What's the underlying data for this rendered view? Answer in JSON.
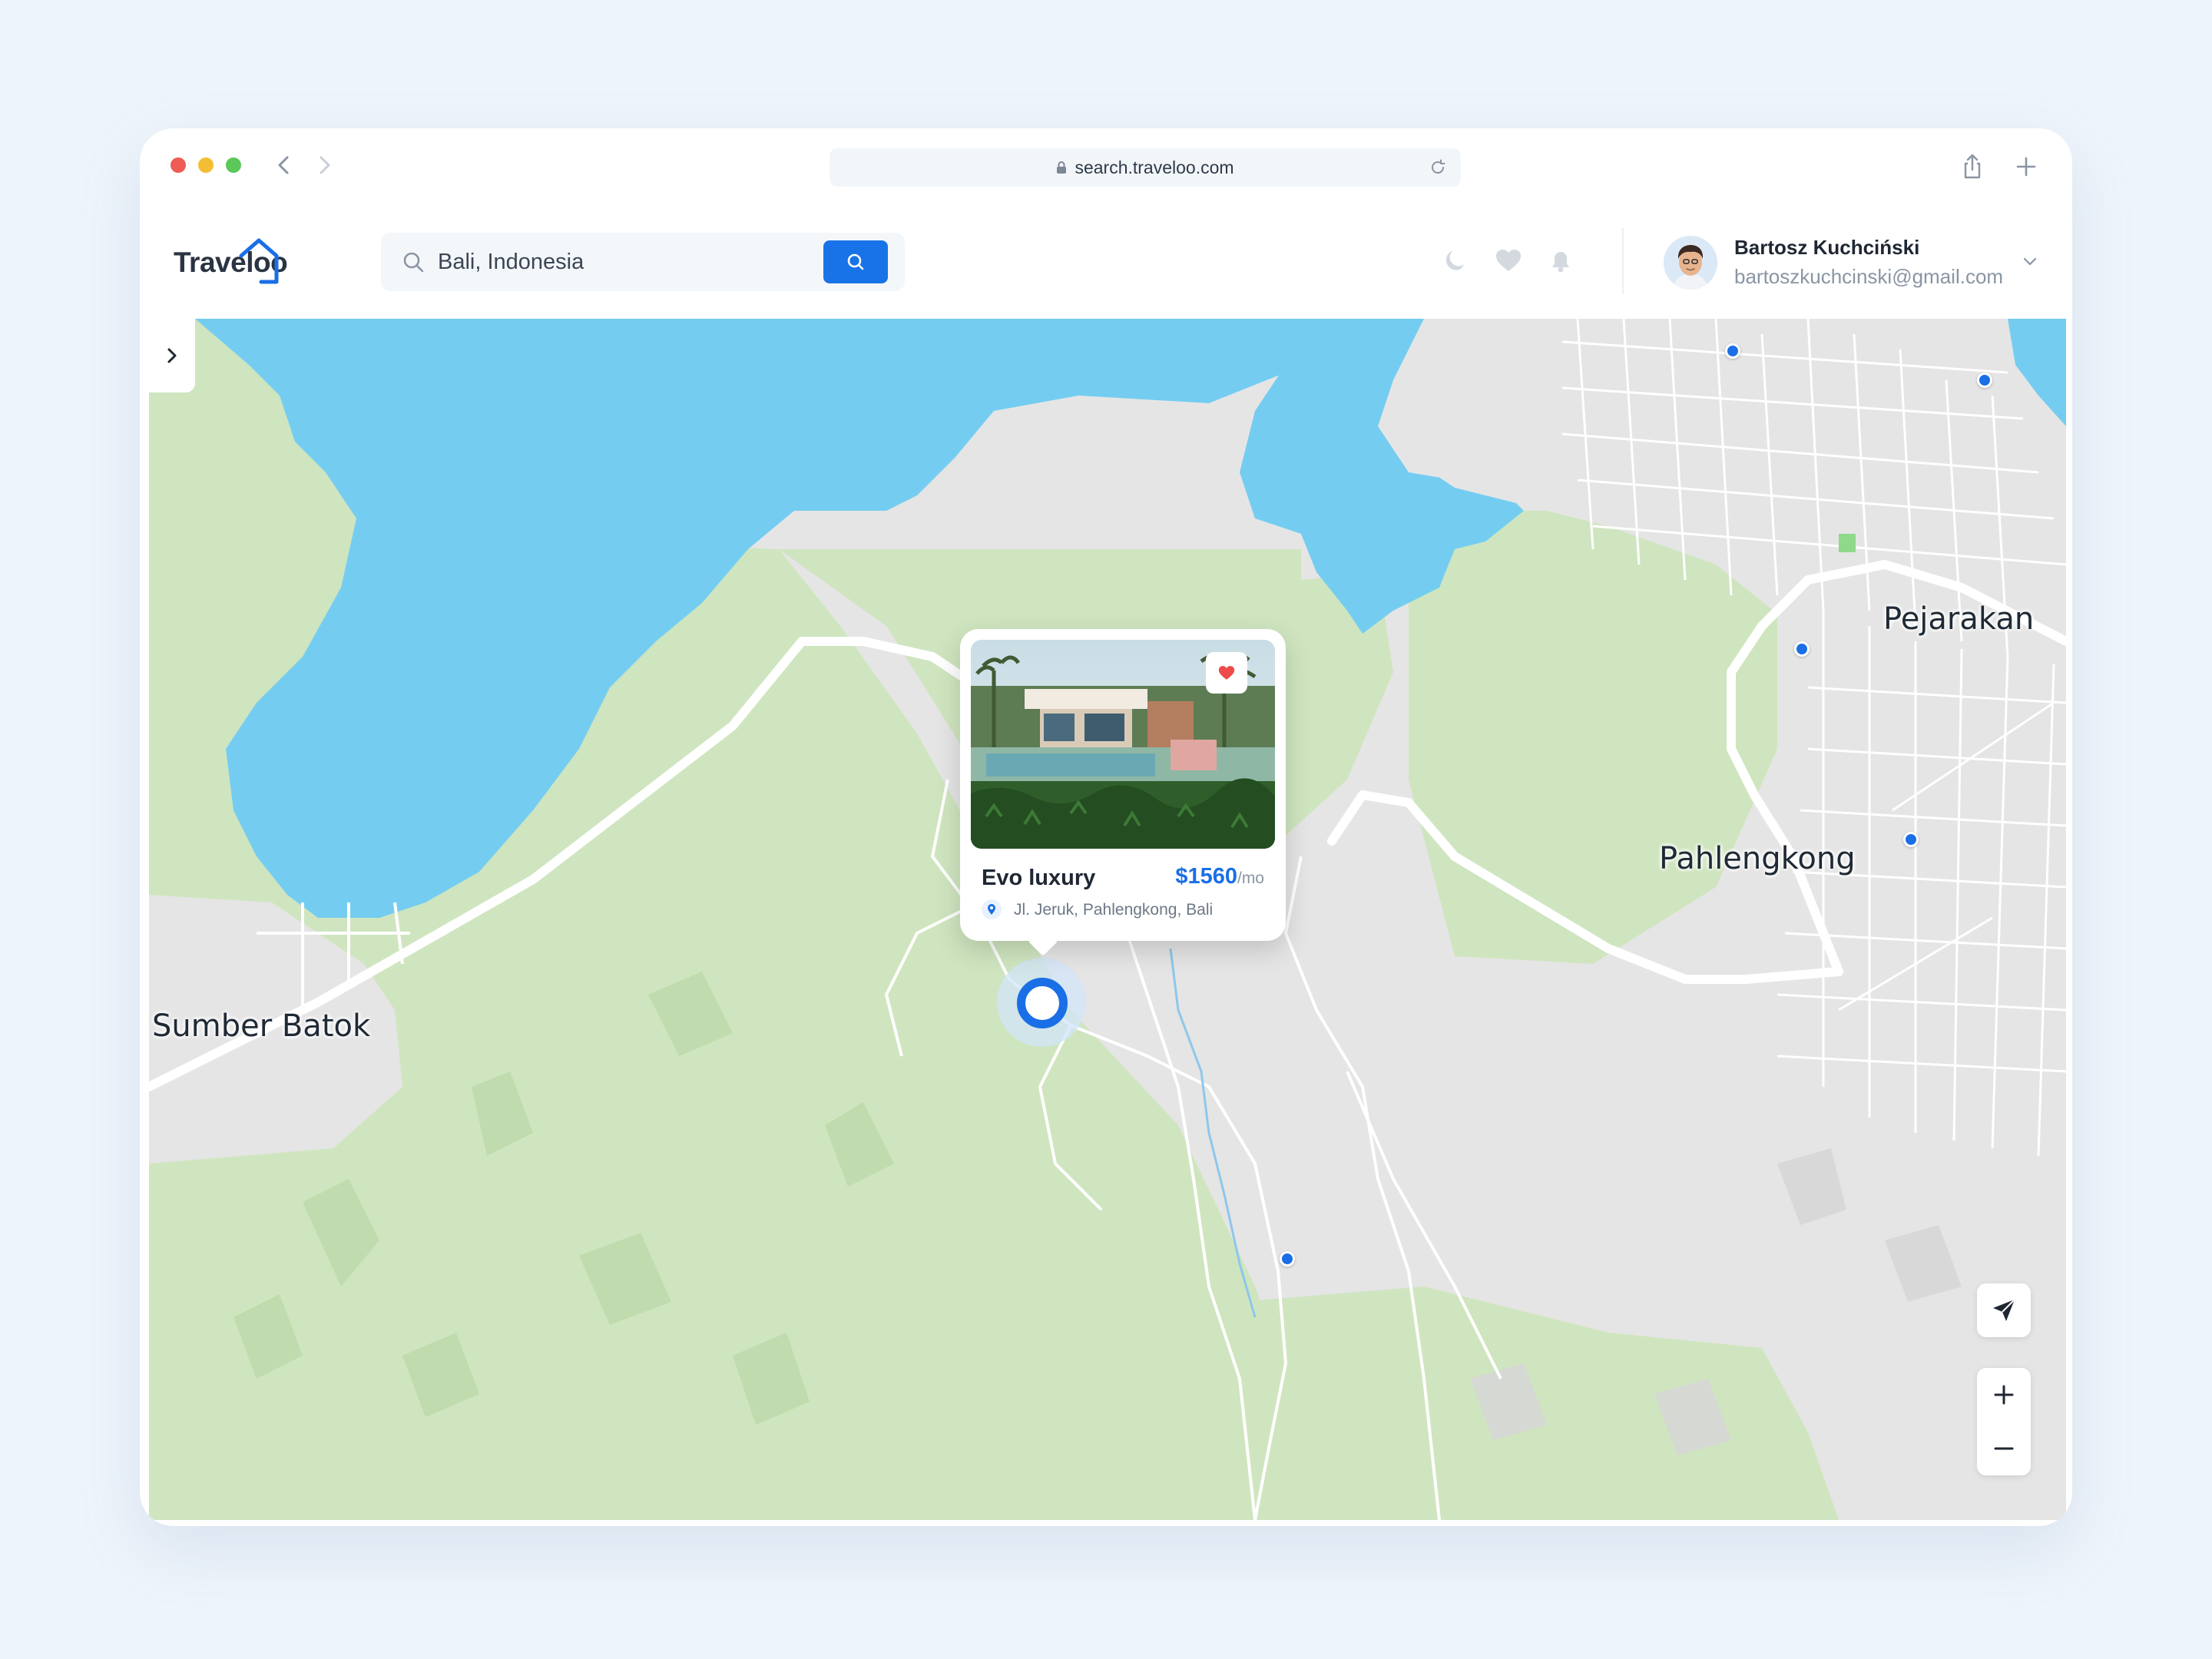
{
  "browser": {
    "url": "search.traveloo.com"
  },
  "app": {
    "logo_text": "Traveloo",
    "accent_color": "#1873e8"
  },
  "search": {
    "value": "Bali, Indonesia",
    "icon": "search-icon",
    "button_icon": "search-icon"
  },
  "header_icons": [
    "moon-icon",
    "heart-icon",
    "bell-icon"
  ],
  "user": {
    "name": "Bartosz Kuchciński",
    "email": "bartoszkuchcinski@gmail.com"
  },
  "map": {
    "labels": {
      "pejarakan": "Pejarakan",
      "pahlengkong": "Pahlengkong",
      "sumber_batok": "Sumber Batok"
    },
    "colors": {
      "water": "#74cdf1",
      "forest": "#cfe5bf",
      "land": "#e5e5e5",
      "road": "#ffffff",
      "pin": "#1a6fe6"
    }
  },
  "listing_card": {
    "title": "Evo luxury",
    "price": "$1560",
    "price_unit": "/mo",
    "address": "Jl. Jeruk, Pahlengkong, Bali",
    "favorited": true
  },
  "controls": {
    "navigate": "navigation-arrow-icon",
    "zoom_in": "plus-icon",
    "zoom_out": "minus-icon"
  }
}
